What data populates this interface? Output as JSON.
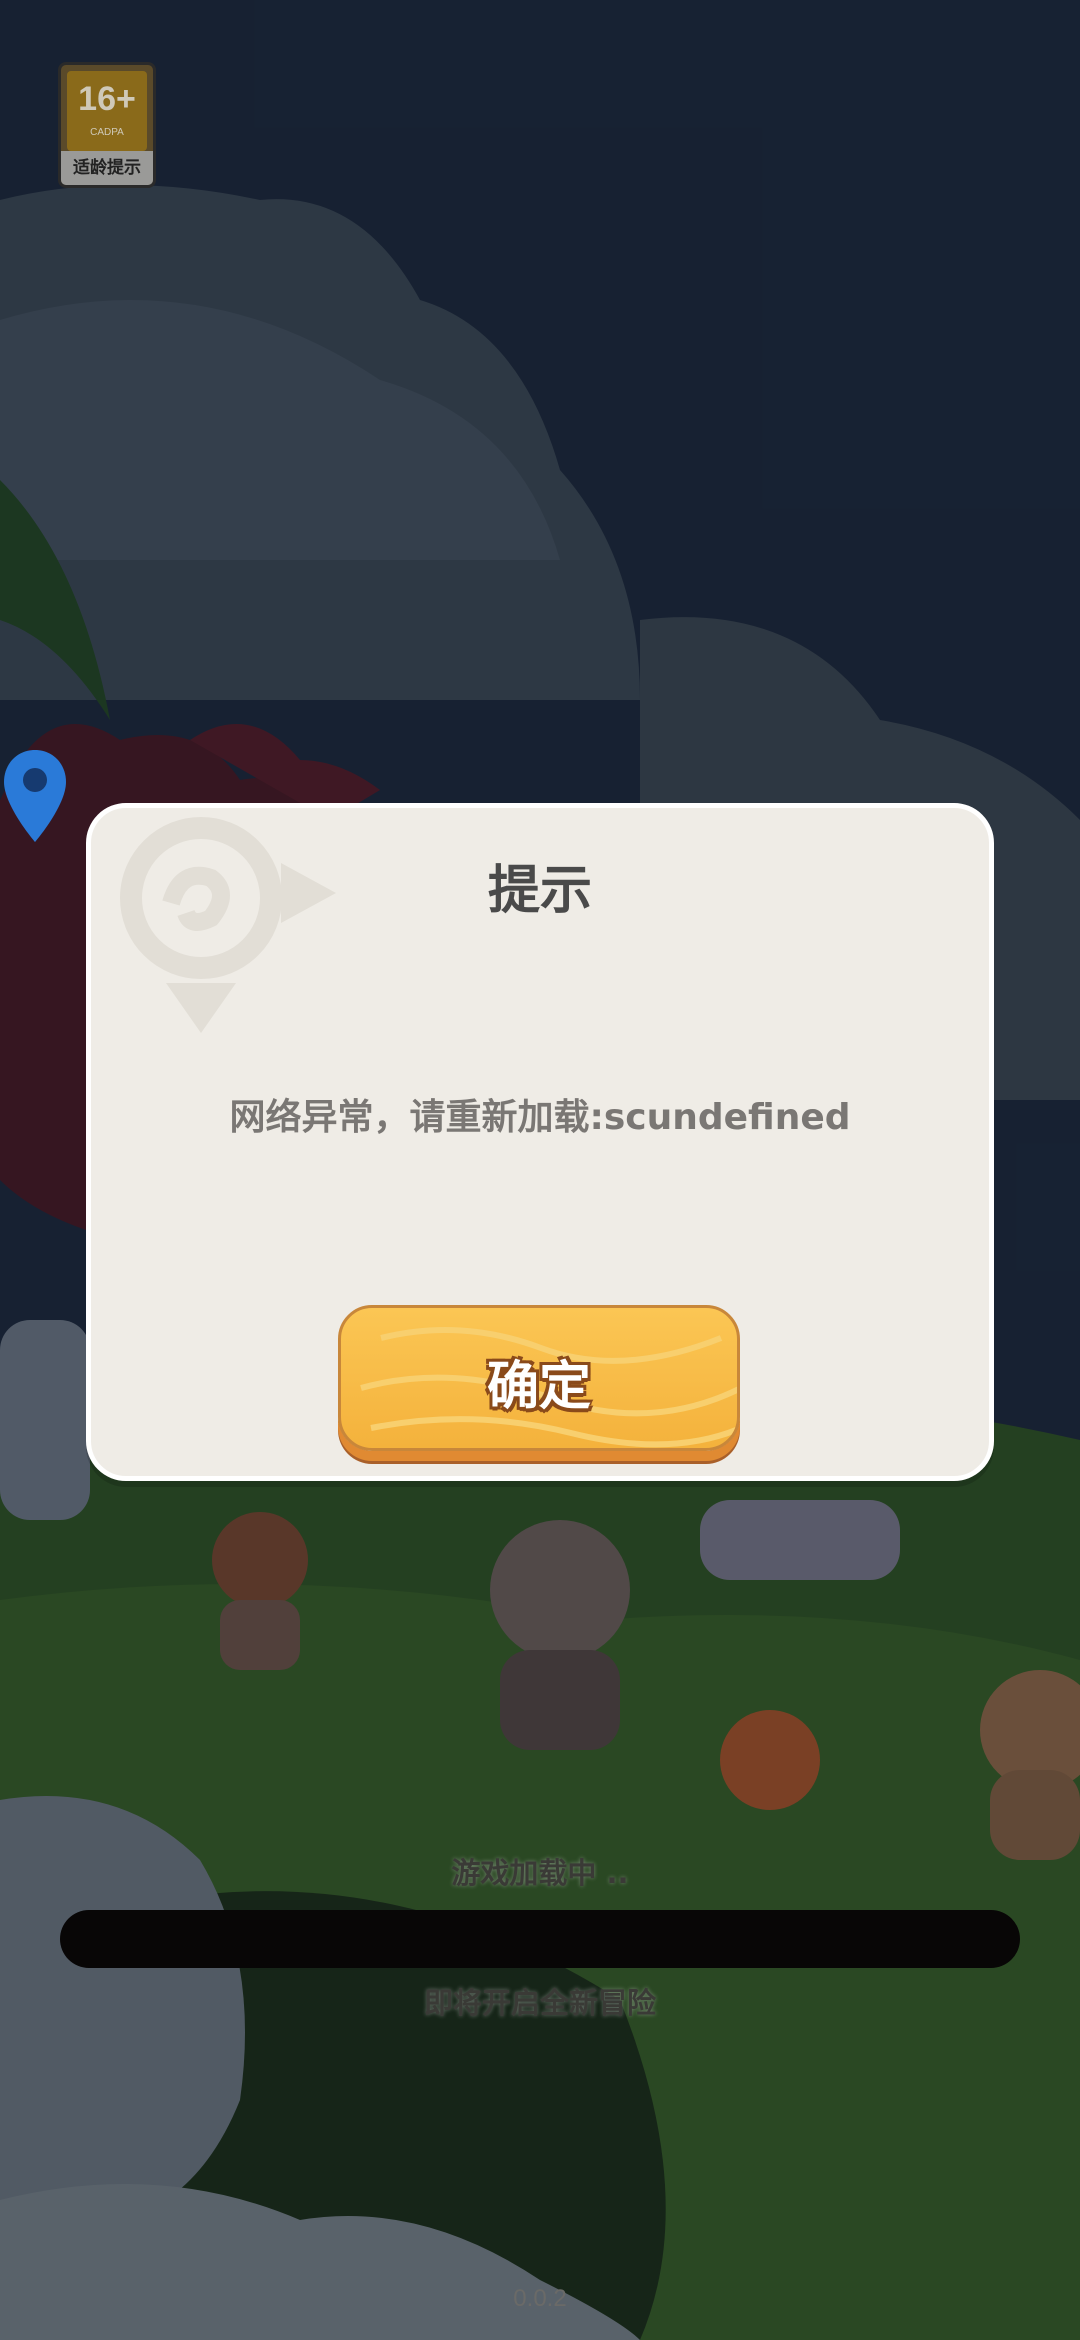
{
  "age_rating": {
    "number": "16+",
    "org": "CADPA",
    "label": "适龄提示"
  },
  "dialog": {
    "title": "提示",
    "message": "网络异常，请重新加载:scundefined",
    "confirm_label": "确定"
  },
  "loading": {
    "status_text": "游戏加载中 ..",
    "progress": 0,
    "tagline": "即将开启全新冒险"
  },
  "version": "0.0.2",
  "colors": {
    "dialog_bg": "#efece6",
    "button": "#f7b843",
    "progress_track": "#080606"
  },
  "icons": [
    "age-rating-icon",
    "location-pin-icon",
    "emblem-icon"
  ]
}
